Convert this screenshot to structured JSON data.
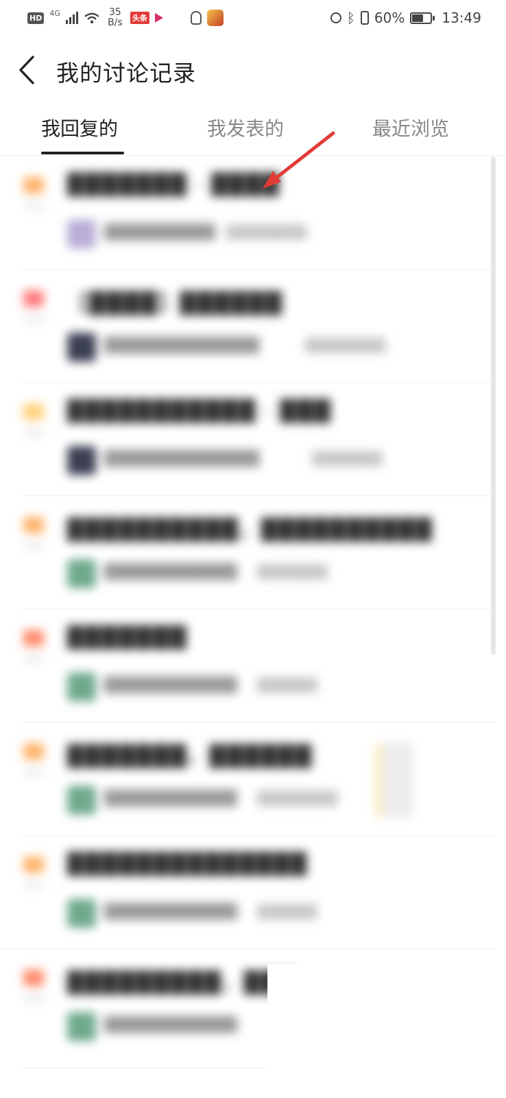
{
  "status_bar": {
    "network_badge": "HD",
    "signal_label": "4G",
    "speed_value": "35",
    "speed_unit": "B/s",
    "toutiao_label": "头条",
    "battery_percent_text": "60%",
    "battery_level": 0.6,
    "time": "13:49",
    "icons": [
      "hd-icon",
      "signal-icon",
      "wifi-icon",
      "toutiao-icon",
      "video-play-icon",
      "qq-icon",
      "game-icon",
      "alarm-icon",
      "bluetooth-icon",
      "vibrate-icon",
      "battery-icon"
    ]
  },
  "header": {
    "title": "我的讨论记录",
    "back_icon": "chevron-left-icon"
  },
  "tabs": [
    {
      "label": "我回复的",
      "active": true
    },
    {
      "label": "我发表的",
      "active": false
    },
    {
      "label": "最近浏览",
      "active": false
    }
  ],
  "list": {
    "note": "",
    "items": [
      {
        "title": "███████ · ████",
        "meta_name": "██████████",
        "meta_time": "████████",
        "rank_color": "#ffb36b",
        "avatar_color": "#b8aed6"
      },
      {
        "title": "【████】██████",
        "meta_name": "██████████████",
        "meta_time": "████████",
        "rank_color": "#ff7a7a",
        "avatar_color": "#3b3f52"
      },
      {
        "title": "███████████ · ███",
        "meta_name": "██████████████",
        "meta_time": "███████",
        "rank_color": "#ffd07a",
        "avatar_color": "#3b3f52"
      },
      {
        "title": "██████████，██████████",
        "meta_name": "████████████",
        "meta_time": "███████",
        "rank_color": "#ffb36b",
        "avatar_color": "#6fa98c"
      },
      {
        "title": "███████",
        "meta_name": "████████████",
        "meta_time": "██████",
        "rank_color": "#ff8a6b",
        "avatar_color": "#6fa98c"
      },
      {
        "title": "███████，██████",
        "meta_name": "████████████",
        "meta_time": "████████",
        "rank_color": "#ffb36b",
        "avatar_color": "#6fa98c"
      },
      {
        "title": "██████████████",
        "meta_name": "████████████",
        "meta_time": "██████",
        "rank_color": "#ffb36b",
        "avatar_color": "#6fa98c"
      },
      {
        "title": "█████████，███",
        "meta_name": "████████████",
        "meta_time": "",
        "rank_color": "#ff8a6b",
        "avatar_color": "#6fa98c"
      }
    ]
  },
  "annotation": {
    "arrow_color": "#e03c35"
  }
}
